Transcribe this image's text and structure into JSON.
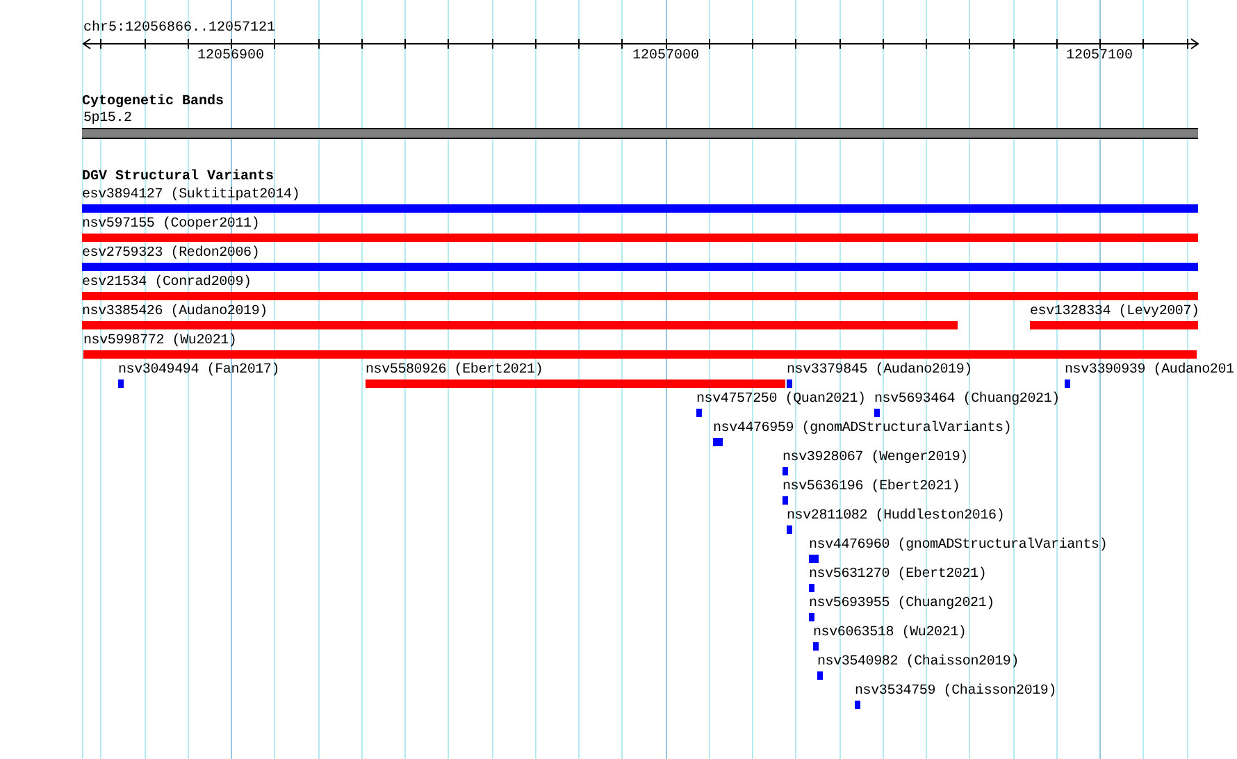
{
  "ruler": {
    "region": "chr5:12056866..12057121",
    "labels": [
      "12056900",
      "12057000",
      "12057100"
    ]
  },
  "cytoband_track": {
    "title": "Cytogenetic Bands",
    "band": "5p15.2"
  },
  "variant_track": {
    "title": "DGV Structural Variants",
    "features": [
      {
        "label": "esv3894127 (Suktitipat2014)",
        "color": "#0000ff"
      },
      {
        "label": "nsv597155 (Cooper2011)",
        "color": "#ff0000"
      },
      {
        "label": "esv2759323 (Redon2006)",
        "color": "#0000ff"
      },
      {
        "label": "esv21534 (Conrad2009)",
        "color": "#ff0000"
      },
      {
        "label": "nsv3385426 (Audano2019)",
        "color": "#ff0000"
      },
      {
        "label": "esv1328334 (Levy2007)",
        "color": "#ff0000"
      },
      {
        "label": "nsv5998772 (Wu2021)",
        "color": "#ff0000"
      },
      {
        "label": "nsv3049494 (Fan2017)",
        "color": "#0000ff"
      },
      {
        "label": "nsv5580926 (Ebert2021)",
        "color": "#ff0000"
      },
      {
        "label": "nsv3379845 (Audano2019)",
        "color": "#0000ff"
      },
      {
        "label": "nsv3390939 (Audano201",
        "color": "#0000ff"
      },
      {
        "label": "nsv4757250 (Quan2021)",
        "color": "#0000ff"
      },
      {
        "label": "nsv5693464 (Chuang2021)",
        "color": "#0000ff"
      },
      {
        "label": "nsv4476959 (gnomADStructuralVariants)",
        "color": "#0000ff"
      },
      {
        "label": "nsv3928067 (Wenger2019)",
        "color": "#0000ff"
      },
      {
        "label": "nsv5636196 (Ebert2021)",
        "color": "#0000ff"
      },
      {
        "label": "nsv2811082 (Huddleston2016)",
        "color": "#0000ff"
      },
      {
        "label": "nsv4476960 (gnomADStructuralVariants)",
        "color": "#0000ff"
      },
      {
        "label": "nsv5631270 (Ebert2021)",
        "color": "#0000ff"
      },
      {
        "label": "nsv5693955 (Chuang2021)",
        "color": "#0000ff"
      },
      {
        "label": "nsv6063518 (Wu2021)",
        "color": "#0000ff"
      },
      {
        "label": "nsv3540982 (Chaisson2019)",
        "color": "#0000ff"
      },
      {
        "label": "nsv3534759 (Chaisson2019)",
        "color": "#0000ff"
      }
    ]
  }
}
